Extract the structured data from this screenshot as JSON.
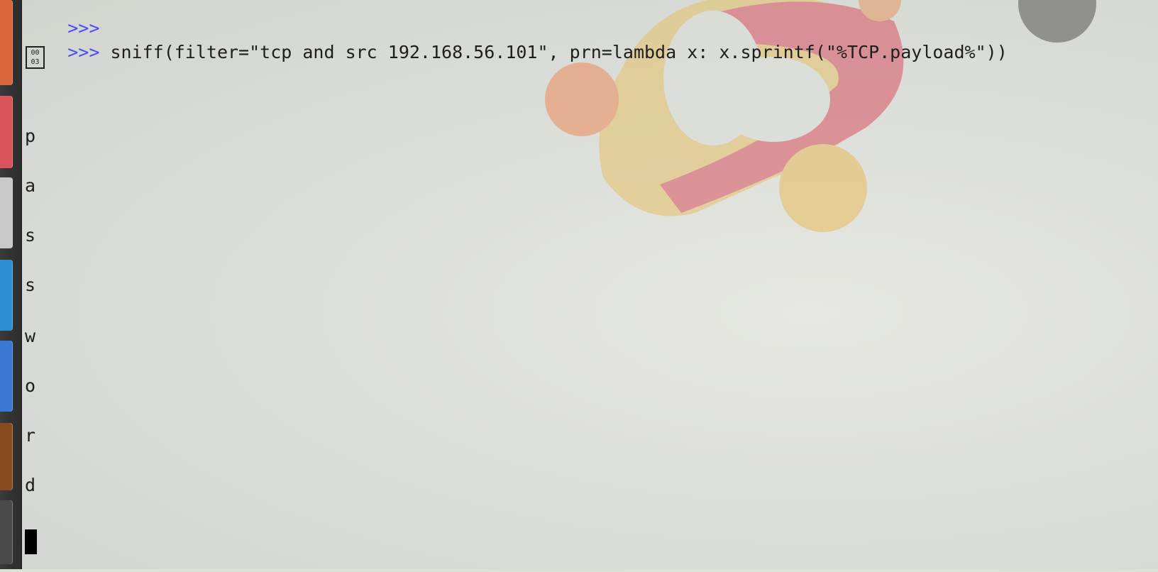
{
  "terminal": {
    "prompt_prev": ">>>",
    "prompt": ">>>",
    "command": "sniff(filter=\"tcp and src 192.168.56.101\", prn=lambda x: x.sprintf(\"%TCP.payload%\"))",
    "unknown_glyph": {
      "top": "00",
      "bottom": "03"
    },
    "output_chars": [
      "p",
      "a",
      "s",
      "s",
      "w",
      "o",
      "r",
      "d"
    ]
  },
  "colors": {
    "prompt": "#4b4bf5",
    "text": "#1e1e1e",
    "launcher": "#2c2c2c"
  },
  "icons": [
    "launcher-app-icon",
    "wallpaper-logo"
  ]
}
